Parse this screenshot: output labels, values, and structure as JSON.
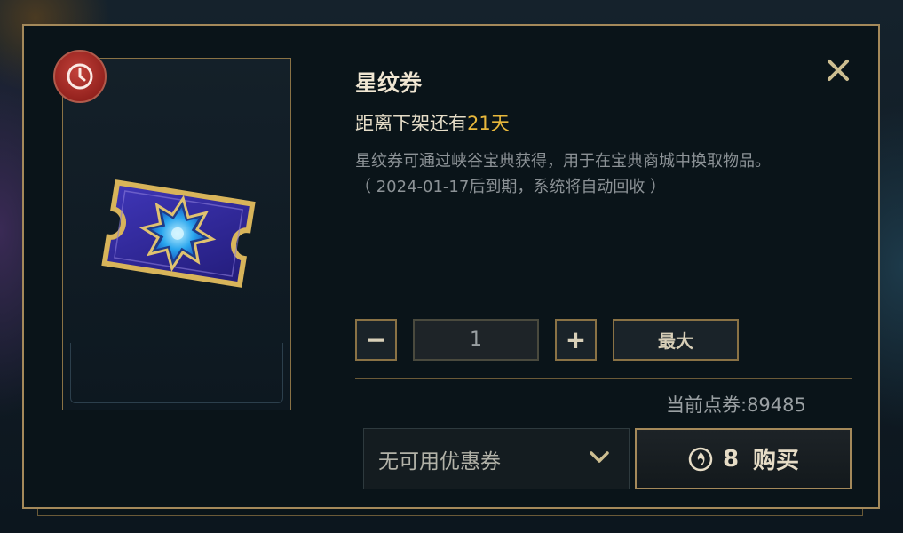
{
  "item": {
    "name": "星纹券",
    "expire_prefix": "距离下架还有",
    "expire_days": "21天",
    "description_line1": "星纹券可通过峡谷宝典获得，用于在宝典商城中换取物品。",
    "description_line2": "（ 2024-01-17后到期，系统将自动回收 ）",
    "badge_icon": "clock-icon",
    "image_icon": "star-ticket-icon"
  },
  "quantity": {
    "decrement_label": "−",
    "value": "1",
    "increment_label": "+",
    "max_label": "最大"
  },
  "balance": {
    "text": "当前点券:89485"
  },
  "coupon": {
    "selected": "无可用优惠券",
    "icon": "chevron-down-icon"
  },
  "buy": {
    "price": "8",
    "label": "购买",
    "currency_icon": "rp-coin-icon"
  },
  "close_icon": "close-icon",
  "colors": {
    "gold_border": "#a4895a",
    "highlight_days": "#e8b83c",
    "badge_red": "#b8322c"
  }
}
